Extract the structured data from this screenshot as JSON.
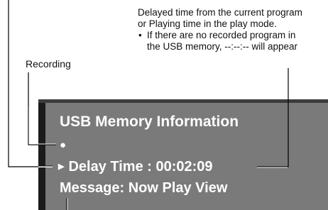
{
  "annotations": {
    "delay": {
      "line1": "Delayed time from the current program",
      "line2": "or Playing time in the play mode.",
      "bullet": "•",
      "bullet_line1": "If there are no recorded program in",
      "bullet_line2": "the USB memory, --:--:-- will appear"
    },
    "recording": "Recording"
  },
  "screen": {
    "title": "USB Memory Information",
    "rec_indicator": "●",
    "delay_arrow": "▶",
    "delay_text": "Delay Time : 00:02:09",
    "message_text": "Message: Now Play View"
  },
  "colors": {
    "panel": "#7a7a7a",
    "panel_edge": "#1b1b1b",
    "screen_text": "#ffffff",
    "leader": "#000000"
  }
}
